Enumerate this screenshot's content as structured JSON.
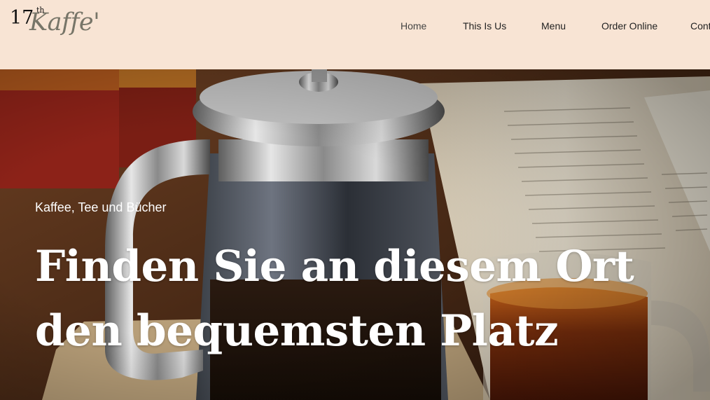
{
  "header": {
    "logo": {
      "number": "17",
      "superscript": "th",
      "script": "Kaffe'"
    },
    "nav": [
      {
        "label": "Home",
        "active": true
      },
      {
        "label": "This Is Us",
        "active": false
      },
      {
        "label": "Menu",
        "active": false
      },
      {
        "label": "Order Online",
        "active": false
      },
      {
        "label": "Cont",
        "active": false
      }
    ]
  },
  "hero": {
    "kicker": "Kaffee, Tee und Bücher",
    "title_line1": "Finden Sie an diesem Ort",
    "title_line2": "den bequemsten Platz"
  },
  "colors": {
    "header_bg": "#f8e4d4",
    "text_dark": "#222222",
    "hero_text": "#ffffff"
  }
}
